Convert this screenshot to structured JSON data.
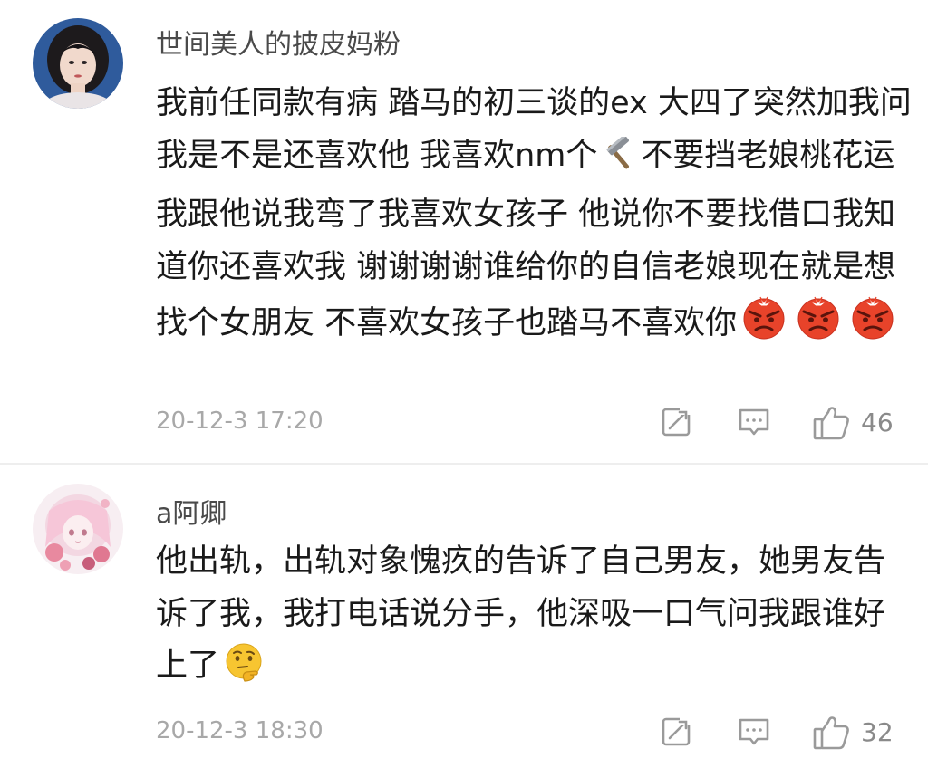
{
  "comments": [
    {
      "username": "世间美人的披皮妈粉",
      "text_before": "我前任同款有病 踏马的初三谈的ex 大四了突然加我问我是不是还喜欢他 我喜欢nm个",
      "text_middle": "不要挡老娘桃花运 我跟他说我弯了我喜欢女孩子 他说你不要找借口我知道你还喜欢我 谢谢谢谢谁给你的自信老娘现在就是想找个女朋友 不喜欢女孩子也踏马不喜欢你",
      "inline_icons": [
        "hammer-emoji-icon",
        "angry-face-emoji-icon",
        "angry-face-emoji-icon",
        "angry-face-emoji-icon"
      ],
      "timestamp": "20-12-3 17:20",
      "likes": "46"
    },
    {
      "username": "a阿卿",
      "text_before": "他出轨，出轨对象愧疚的告诉了自己男友，她男友告诉了我，我打电话说分手，他深吸一口气问我跟谁好上了",
      "inline_icons": [
        "thinking-face-emoji-icon"
      ],
      "timestamp": "20-12-3 18:30",
      "likes": "32"
    }
  ],
  "action_icons": [
    "share-icon",
    "reply-icon",
    "like-icon"
  ],
  "colors": {
    "username": "#4a4a4a",
    "text": "#1a1a1a",
    "meta": "#a8a8a8",
    "icon": "#9a9a9a",
    "angry_red": "#e8432a",
    "emoji_yellow": "#f7c531"
  }
}
